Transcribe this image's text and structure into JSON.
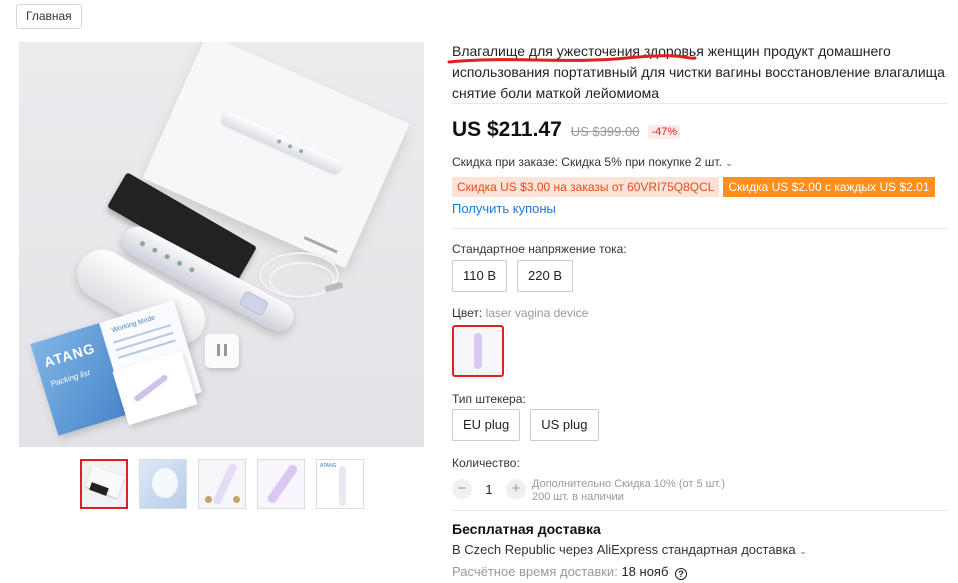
{
  "breadcrumb": {
    "home": "Главная"
  },
  "gallery": {
    "leaflet_brand": "ATANG",
    "leaflet_subtitle": "Packing list",
    "leaflet_header": "Working Mode",
    "thumb_text": "ATANG"
  },
  "product": {
    "title": "Влагалище для ужесточения здоровья женщин продукт домашнего использования портативный для чистки вагины восстановление влагалища снятие боли маткой лейомиома",
    "price": "US $211.47",
    "old_price": "US $399.00",
    "discount_pct": "-47%",
    "order_discount": "Скидка при заказе: Скидка 5% при покупке 2 шт.",
    "coupon_a": "Скидка US $3.00 на заказы от 60VRI75Q8QCL",
    "coupon_b": "Скидка US $2.00 с каждых US $2.01",
    "get_coupons": "Получить купоны"
  },
  "voltage": {
    "label": "Стандартное напряжение тока:",
    "options": [
      "110 В",
      "220 В"
    ]
  },
  "color": {
    "label": "Цвет:",
    "value": "laser vagina device"
  },
  "plug": {
    "label": "Тип штекера:",
    "options": [
      "EU plug",
      "US plug"
    ]
  },
  "quantity": {
    "label": "Количество:",
    "value": "1",
    "minus": "−",
    "plus": "+",
    "note_1": "Дополнительно Скидка 10% (от 5 шт.)",
    "note_2": "200 шт. в наличии"
  },
  "shipping": {
    "title": "Бесплатная доставка",
    "line": "В Czech Republic через AliExpress стандартная доставка",
    "eta_label": "Расчётное время доставки:",
    "eta_value": "18 нояб"
  },
  "colors": {
    "accent_red": "#e02020",
    "price": "#111111",
    "link": "#1a7ad6",
    "coupon_orange": "#ff8f1f"
  }
}
